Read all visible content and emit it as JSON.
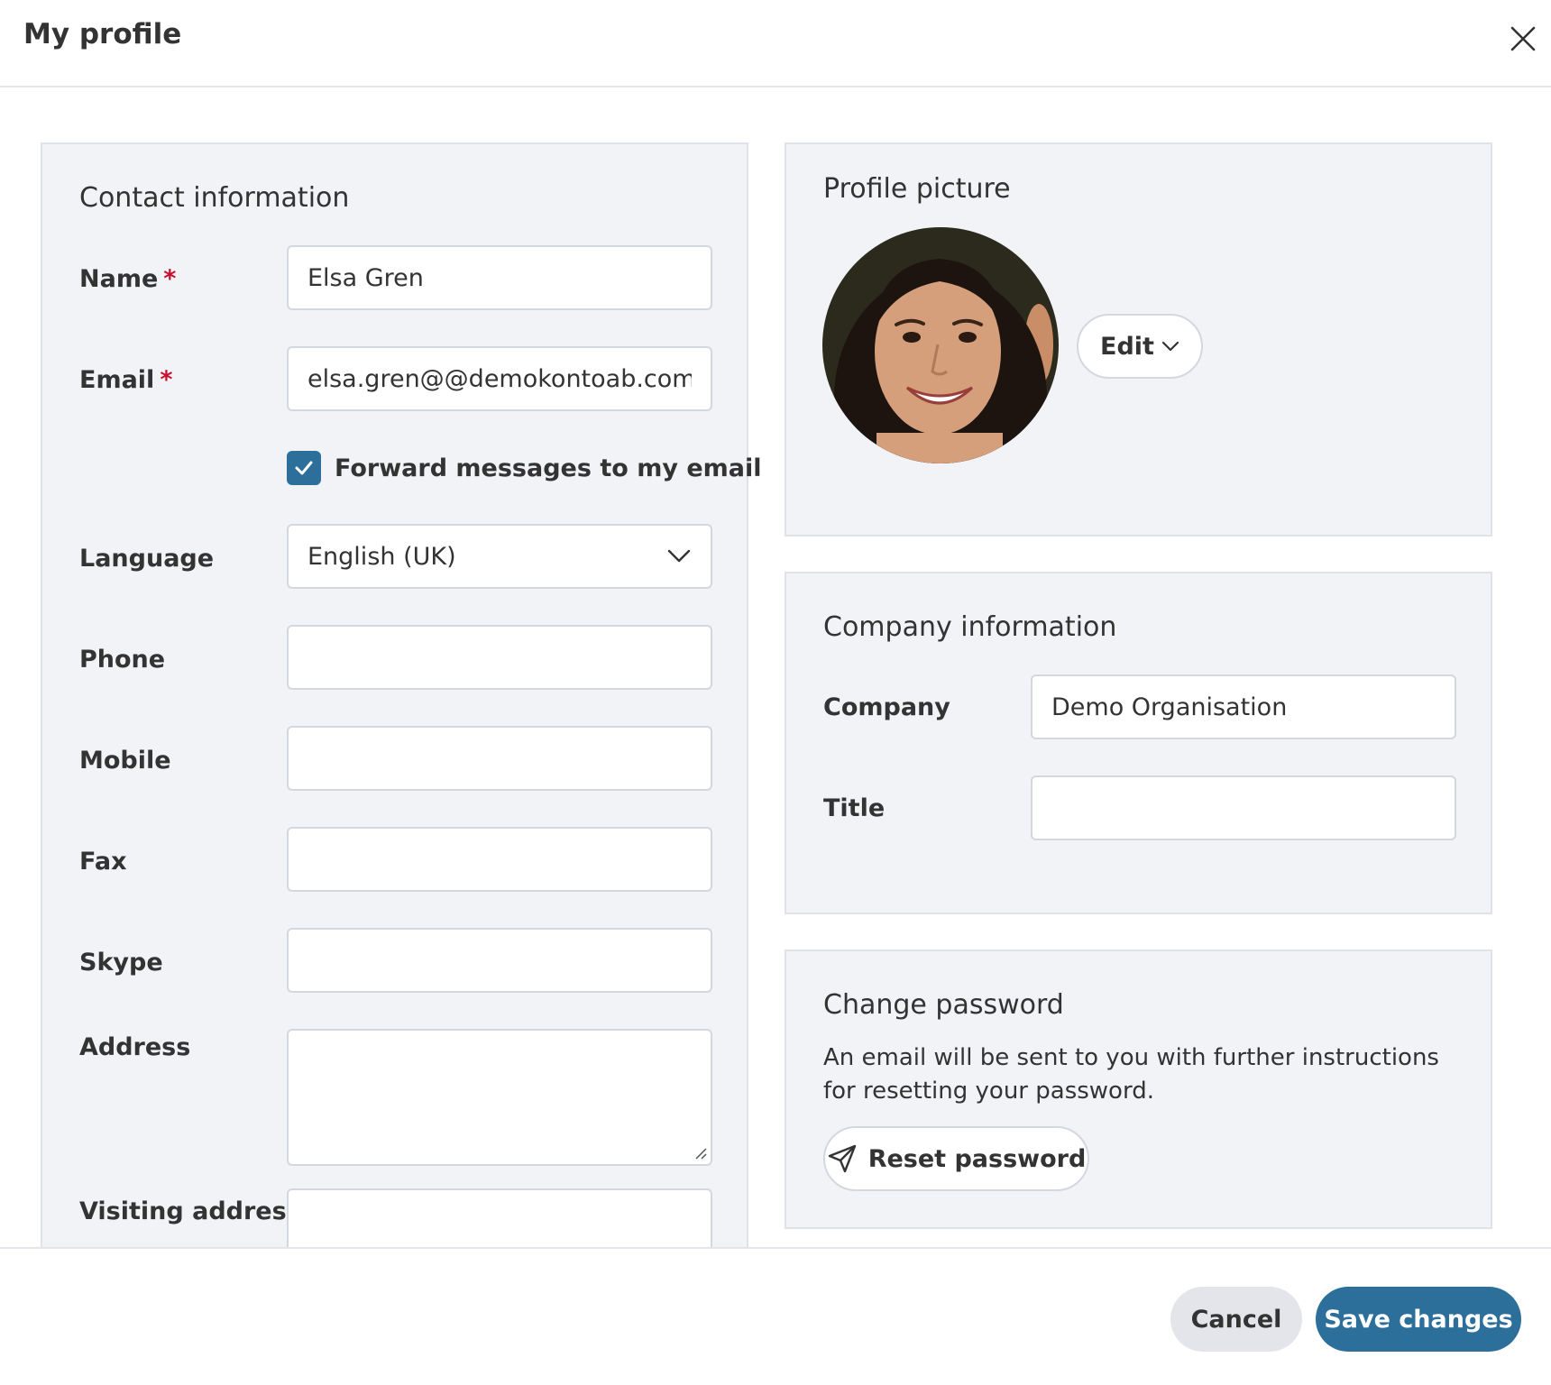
{
  "header": {
    "title": "My profile"
  },
  "contact": {
    "title": "Contact information",
    "name": {
      "label": "Name",
      "required_mark": "*",
      "value": "Elsa Gren"
    },
    "email": {
      "label": "Email",
      "required_mark": "*",
      "value": "elsa.gren@@demokontoab.com"
    },
    "forward": {
      "label": "Forward messages to my email",
      "checked": true
    },
    "language": {
      "label": "Language",
      "value": "English (UK)"
    },
    "phone": {
      "label": "Phone",
      "value": ""
    },
    "mobile": {
      "label": "Mobile",
      "value": ""
    },
    "fax": {
      "label": "Fax",
      "value": ""
    },
    "skype": {
      "label": "Skype",
      "value": ""
    },
    "address": {
      "label": "Address",
      "value": ""
    },
    "visiting_address": {
      "label": "Visiting address",
      "value": ""
    }
  },
  "profile_picture": {
    "title": "Profile picture",
    "edit_label": "Edit"
  },
  "company": {
    "title": "Company information",
    "company": {
      "label": "Company",
      "value": "Demo Organisation"
    },
    "job_title": {
      "label": "Title",
      "value": ""
    }
  },
  "password": {
    "title": "Change password",
    "description": "An email will be sent to you with further instructions for resetting your password.",
    "reset_label": "Reset password"
  },
  "footer": {
    "cancel_label": "Cancel",
    "save_label": "Save changes"
  },
  "colors": {
    "primary": "#2c6f9b",
    "panel_bg": "#f1f3f6",
    "required": "#c8102e"
  }
}
